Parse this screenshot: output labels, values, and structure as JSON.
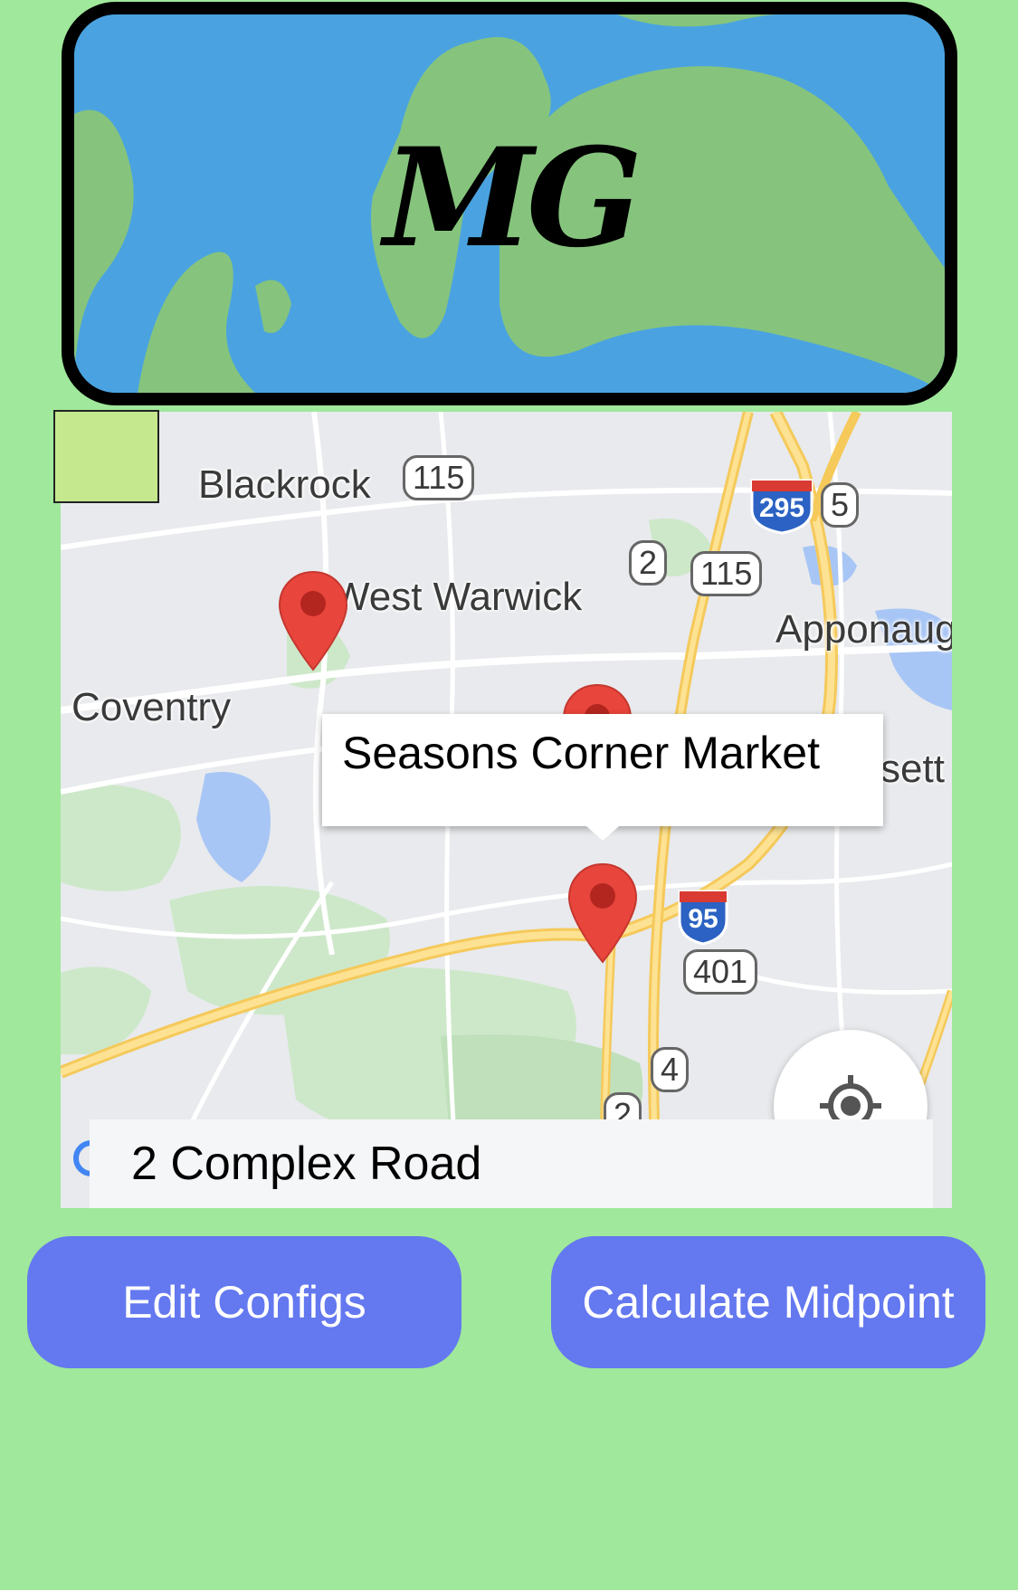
{
  "logo": {
    "text": "MG"
  },
  "map": {
    "places": [
      {
        "id": "blackrock",
        "label": "Blackrock"
      },
      {
        "id": "west-warwick",
        "label": "West Warwick"
      },
      {
        "id": "coventry",
        "label": "Coventry"
      },
      {
        "id": "apponaug",
        "label": "Apponaug"
      },
      {
        "id": "sett",
        "label": "sett"
      }
    ],
    "route_shields": [
      "115",
      "2",
      "115",
      "5",
      "401",
      "4",
      "2"
    ],
    "interstate_shields": [
      "295",
      "95"
    ],
    "callout": {
      "title": "Seasons Corner Market"
    },
    "address_input": {
      "value": "2 Complex Road"
    }
  },
  "buttons": {
    "edit_configs": "Edit Configs",
    "calculate_midpoint": "Calculate Midpoint"
  },
  "colors": {
    "background": "#a0e89b",
    "button": "#6478f0",
    "pin": "#e8453c",
    "water": "#4aa3e0",
    "land": "#86c47d"
  },
  "icons": {
    "locate": "my-location-icon",
    "pin": "map-pin-icon"
  }
}
